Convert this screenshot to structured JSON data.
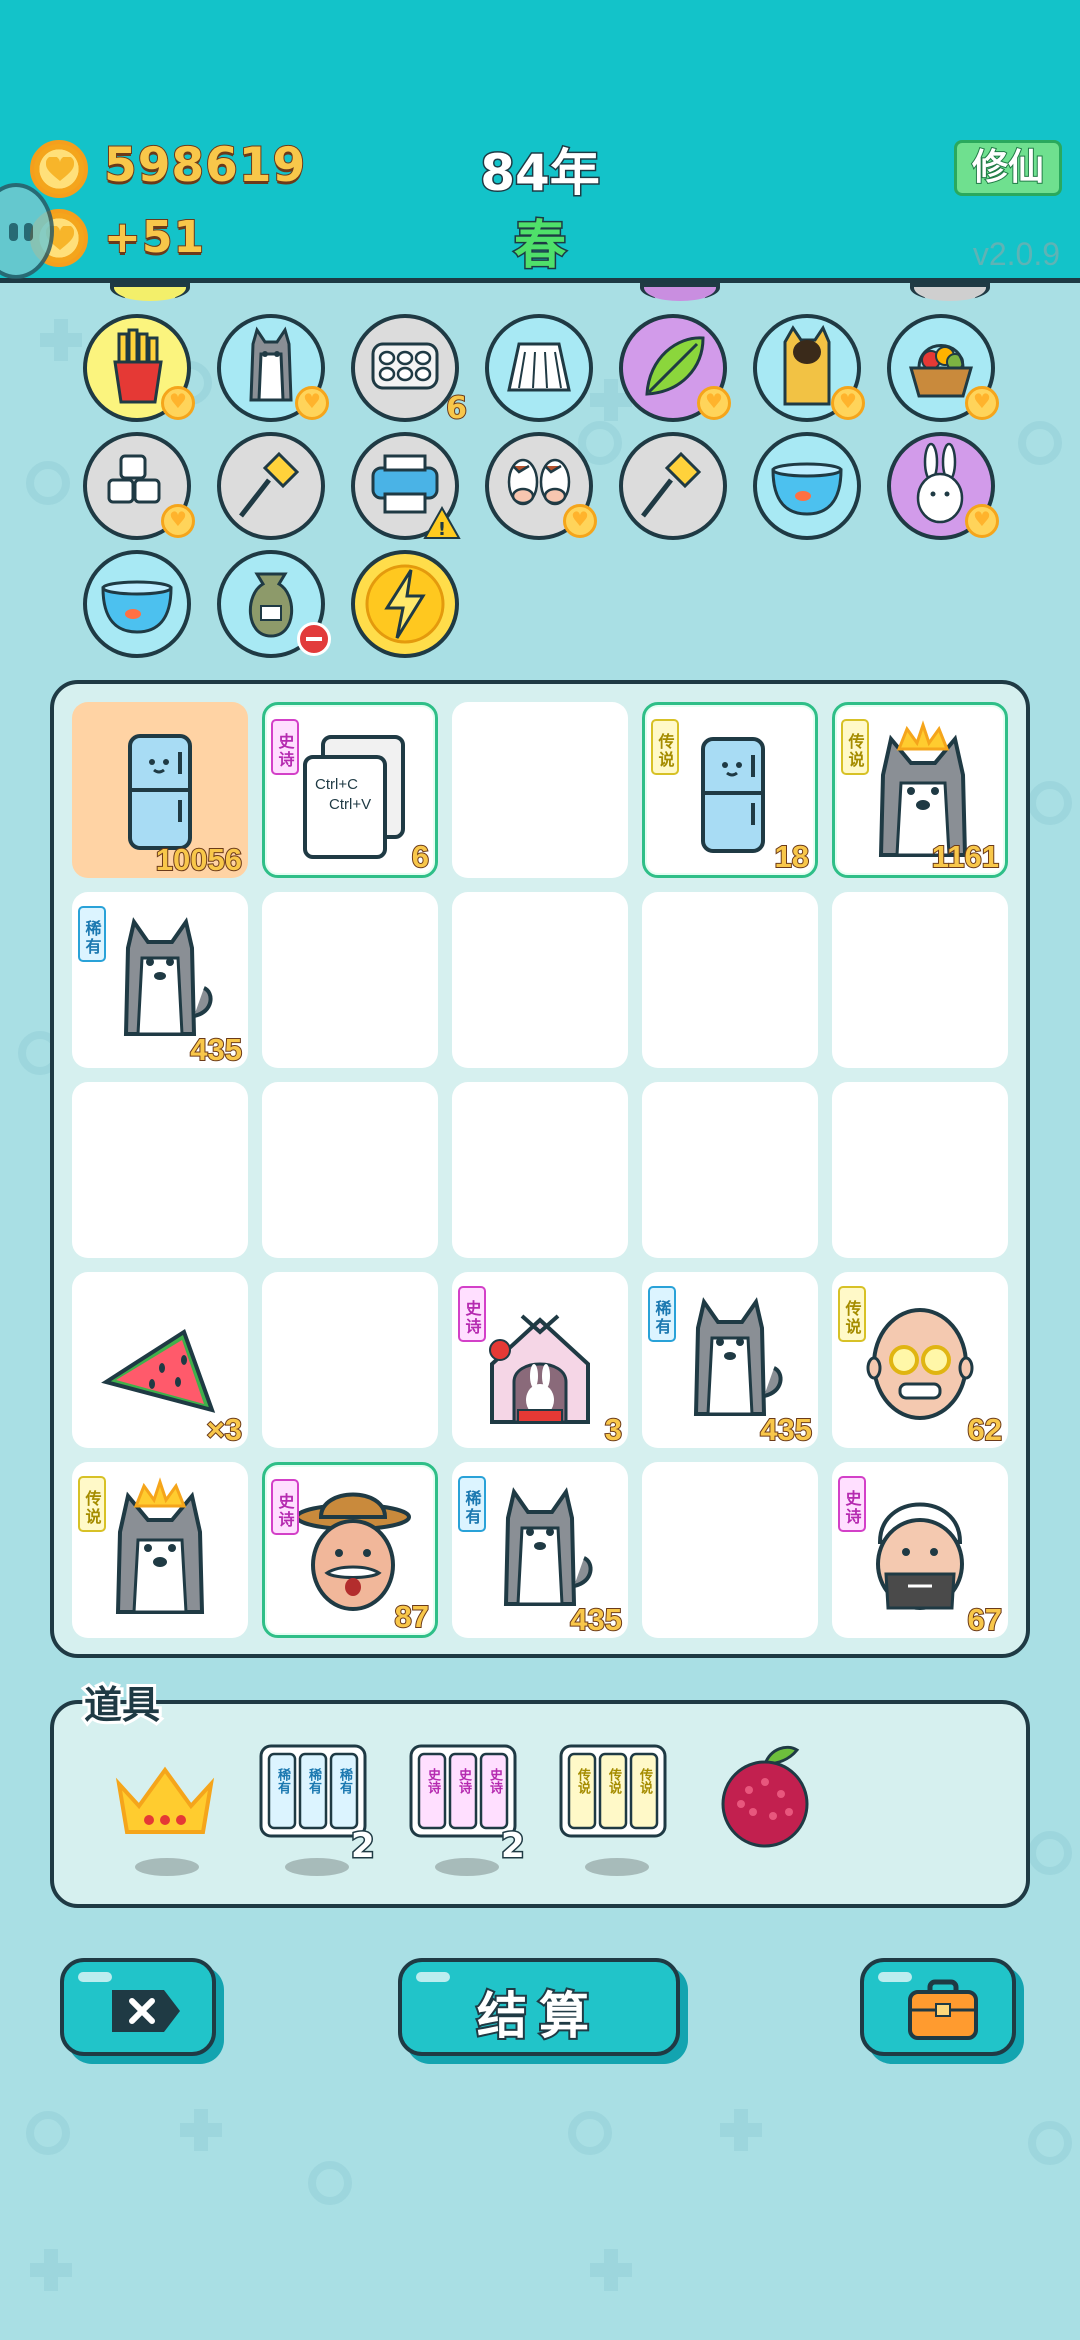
{
  "header": {
    "coins": "598619",
    "income": "+51",
    "year": "84年",
    "season": "春",
    "mode_button": "修仙",
    "version": "v2.0.9"
  },
  "inventory": {
    "items": [
      {
        "name": "fries-icon",
        "badge": "heart"
      },
      {
        "name": "husky-icon",
        "badge": "heart"
      },
      {
        "name": "egg-tray-icon",
        "count": "6"
      },
      {
        "name": "skirt-icon"
      },
      {
        "name": "leaf-icon",
        "badge": "heart"
      },
      {
        "name": "cat-icon",
        "badge": "heart"
      },
      {
        "name": "fruit-basket-icon",
        "badge": "heart"
      },
      {
        "name": "sugar-cubes-icon",
        "badge": "heart"
      },
      {
        "name": "screwdriver-icon"
      },
      {
        "name": "printer-icon",
        "badge": "warning"
      },
      {
        "name": "cow-pair-icon",
        "badge": "heart"
      },
      {
        "name": "screwdriver-icon"
      },
      {
        "name": "fishbowl-icon"
      },
      {
        "name": "rabbit-icon",
        "badge": "heart"
      },
      {
        "name": "fishbowl-icon"
      },
      {
        "name": "sack-icon",
        "badge": "no"
      },
      {
        "name": "lightning-icon"
      }
    ]
  },
  "board": {
    "cells": [
      {
        "item": "fridge",
        "count": "10056"
      },
      {
        "item": "copy-paste",
        "tag": "史诗",
        "count": "6"
      },
      {
        "item": ""
      },
      {
        "item": "fridge",
        "tag": "传说",
        "count": "18"
      },
      {
        "item": "husky-king",
        "tag": "传说",
        "count": "1161"
      },
      {
        "item": "husky",
        "tag": "稀有",
        "count": "435"
      },
      {
        "item": ""
      },
      {
        "item": ""
      },
      {
        "item": ""
      },
      {
        "item": ""
      },
      {
        "item": ""
      },
      {
        "item": ""
      },
      {
        "item": ""
      },
      {
        "item": ""
      },
      {
        "item": ""
      },
      {
        "item": "watermelon",
        "count": "×3"
      },
      {
        "item": ""
      },
      {
        "item": "rabbit-house",
        "tag": "史诗",
        "count": "3"
      },
      {
        "item": "husky",
        "tag": "稀有",
        "count": "435"
      },
      {
        "item": "old-man-glasses",
        "tag": "传说",
        "count": "62"
      },
      {
        "item": "husky-king",
        "tag": "传说"
      },
      {
        "item": "farmer",
        "tag": "史诗",
        "count": "87"
      },
      {
        "item": "husky",
        "tag": "稀有",
        "count": "435"
      },
      {
        "item": ""
      },
      {
        "item": "grandpa",
        "tag": "史诗",
        "count": "67"
      }
    ]
  },
  "tools": {
    "label": "道具",
    "items": [
      {
        "name": "crown-tool"
      },
      {
        "name": "rare-cards-tool",
        "card": "稀有",
        "count": "2"
      },
      {
        "name": "epic-cards-tool",
        "card": "史诗",
        "count": "2"
      },
      {
        "name": "legend-cards-tool",
        "card": "传说"
      },
      {
        "name": "lychee-tool"
      }
    ]
  },
  "buttons": {
    "settle": "结算"
  }
}
